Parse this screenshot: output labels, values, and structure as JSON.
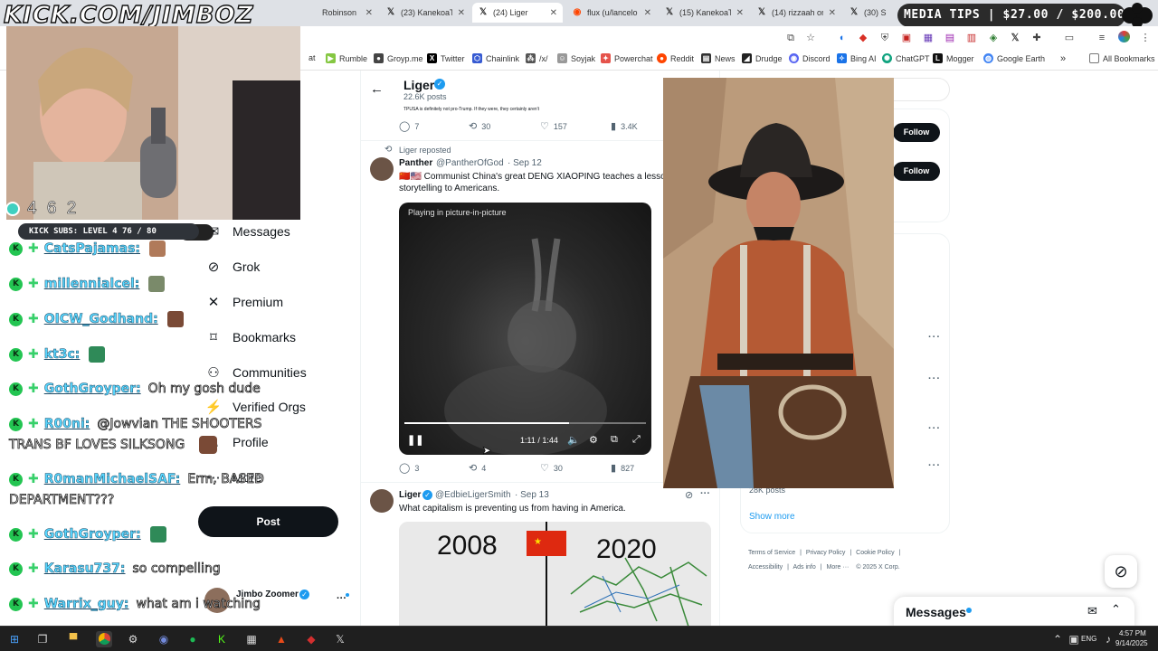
{
  "overlay": {
    "stream_title": "KICK.COM/JIMBOZ",
    "viewer_count": "4 6 2",
    "subs_label": "KICK SUBS: LEVEL 4 76 / 80",
    "media_tips": "MEDIA TIPS | $27.00 / $200.00",
    "chat": [
      {
        "user": "CatsPajamas:",
        "message": ""
      },
      {
        "user": "millennialcel:",
        "message": ""
      },
      {
        "user": "OICW_Godhand:",
        "message": ""
      },
      {
        "user": "kt3c:",
        "message": ""
      },
      {
        "user": "GothGroyper:",
        "message": "Oh my gosh dude"
      },
      {
        "user": "R00ni:",
        "message": "@Jowvian THE SHOOTERS"
      },
      {
        "user": "",
        "message": "TRANS BF LOVES SILKSONG"
      },
      {
        "user": "R0manMichaelSAF:",
        "message": "Erm, BASED"
      },
      {
        "user": "",
        "message": "DEPARTMENT???"
      },
      {
        "user": "GothGroyper:",
        "message": ""
      },
      {
        "user": "Karasu737:",
        "message": "so compelling"
      },
      {
        "user": "Warrix_guy:",
        "message": "what am i watching"
      }
    ]
  },
  "browser": {
    "tabs": [
      {
        "label": "Robinson",
        "icon": "x-icon"
      },
      {
        "label": "(23) KanekoaTh",
        "icon": "x-icon"
      },
      {
        "label": "(24) Liger",
        "icon": "x-icon"
      },
      {
        "label": "flux (u/lancelo",
        "icon": "reddit-icon"
      },
      {
        "label": "(15) KanekoaTh",
        "icon": "x-icon"
      },
      {
        "label": "(14) rizzaah on",
        "icon": "x-icon"
      },
      {
        "label": "(30) S",
        "icon": "x-icon"
      }
    ],
    "bookmarks": [
      {
        "label": "at",
        "icon": ""
      },
      {
        "label": "Rumble",
        "icon": "rumble-icon",
        "color": "#85c742"
      },
      {
        "label": "Groyp.me",
        "icon": "groyp-icon",
        "color": "#444444"
      },
      {
        "label": "Twitter",
        "icon": "x-icon",
        "color": "#000000"
      },
      {
        "label": "Chainlink",
        "icon": "chainlink-icon",
        "color": "#375bd2"
      },
      {
        "label": "/x/",
        "icon": "folder-x-icon",
        "color": "#555555"
      },
      {
        "label": "Soyjak",
        "icon": "soyjak-icon",
        "color": "#999999"
      },
      {
        "label": "Powerchat",
        "icon": "powerchat-icon",
        "color": "#e5534b"
      },
      {
        "label": "Reddit",
        "icon": "reddit-icon",
        "color": "#ff4500"
      },
      {
        "label": "News",
        "icon": "news-icon",
        "color": "#333333"
      },
      {
        "label": "Drudge",
        "icon": "drudge-icon",
        "color": "#222222"
      },
      {
        "label": "Discord",
        "icon": "discord-icon",
        "color": "#5865f2"
      },
      {
        "label": "Bing AI",
        "icon": "bing-icon",
        "color": "#1a73e8"
      },
      {
        "label": "ChatGPT",
        "icon": "chatgpt-icon",
        "color": "#10a37f"
      },
      {
        "label": "Mogger",
        "icon": "mogger-icon",
        "color": "#111111"
      },
      {
        "label": "Google Earth",
        "icon": "earth-icon",
        "color": "#4285f4"
      }
    ],
    "all_bookmarks": "All Bookmarks"
  },
  "nav": {
    "items": [
      "Messages",
      "Grok",
      "Premium",
      "Bookmarks",
      "Communities",
      "Verified Orgs",
      "Profile",
      "More"
    ],
    "post_label": "Post",
    "profile_name": "Jimbo Zoomer"
  },
  "header": {
    "name": "Liger",
    "posts": "22.6K posts",
    "cut_text": "TPUSA is definitely not pro-Trump. If they were, they certainly aren't"
  },
  "post1": {
    "replies": "7",
    "reposts": "30",
    "likes": "157",
    "views": "3.4K"
  },
  "post2": {
    "reposted_by": "Liger reposted",
    "name": "Panther",
    "handle": "@PantherOfGod",
    "date": "· Sep 12",
    "text_line1": "🇨🇳🇺🇸 Communist China's great DENG XIAOPING teaches a lesso",
    "text_line2": "storytelling to Americans.",
    "video_status": "Playing in picture-in-picture",
    "video_time": "1:11 / 1:44",
    "progress": 0.68,
    "replies": "3",
    "reposts": "4",
    "likes": "30",
    "views": "827"
  },
  "post3": {
    "name": "Liger",
    "handle": "@EdbieLigerSmith",
    "date": "· Sep 13",
    "text": "What capitalism is preventing us from having in America.",
    "year_left": "2008",
    "year_right": "2020"
  },
  "right": {
    "follow_label": "Follow",
    "posts_count": "28K posts",
    "show_more": "Show more",
    "footer": [
      "Terms of Service",
      "Privacy Policy",
      "Cookie Policy",
      "Accessibility",
      "Ads info",
      "More ···",
      "© 2025 X Corp."
    ]
  },
  "messages": {
    "title": "Messages"
  },
  "taskbar": {
    "lang": "ENG",
    "time": "4:57 PM",
    "date": "9/14/2025"
  }
}
